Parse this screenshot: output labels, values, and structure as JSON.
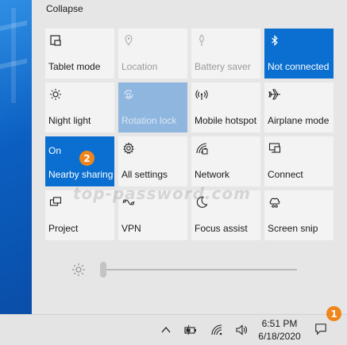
{
  "panel": {
    "collapse_label": "Collapse",
    "tiles": [
      {
        "label": "Tablet mode",
        "icon": "tablet-mode-icon",
        "state": ""
      },
      {
        "label": "Location",
        "icon": "location-icon",
        "state": ""
      },
      {
        "label": "Battery saver",
        "icon": "battery-saver-icon",
        "state": ""
      },
      {
        "label": "Not connected",
        "icon": "bluetooth-icon",
        "state": ""
      },
      {
        "label": "Night light",
        "icon": "night-light-icon",
        "state": ""
      },
      {
        "label": "Rotation lock",
        "icon": "rotation-lock-icon",
        "state": ""
      },
      {
        "label": "Mobile hotspot",
        "icon": "mobile-hotspot-icon",
        "state": ""
      },
      {
        "label": "Airplane mode",
        "icon": "airplane-icon",
        "state": ""
      },
      {
        "label": "Nearby sharing",
        "icon": "nearby-sharing-icon",
        "state": "On"
      },
      {
        "label": "All settings",
        "icon": "gear-icon",
        "state": ""
      },
      {
        "label": "Network",
        "icon": "network-icon",
        "state": ""
      },
      {
        "label": "Connect",
        "icon": "connect-icon",
        "state": ""
      },
      {
        "label": "Project",
        "icon": "project-icon",
        "state": ""
      },
      {
        "label": "VPN",
        "icon": "vpn-icon",
        "state": ""
      },
      {
        "label": "Focus assist",
        "icon": "moon-icon",
        "state": ""
      },
      {
        "label": "Screen snip",
        "icon": "screen-snip-icon",
        "state": ""
      }
    ],
    "watermark": "top-password.com",
    "brightness_level": 0.0
  },
  "badges": {
    "step_one": "1",
    "step_two": "2"
  },
  "colors": {
    "accent": "#0a6fd0",
    "tile": "#f3f3f3",
    "badge": "#f0861b"
  },
  "taskbar": {
    "time": "6:51 PM",
    "date": "6/18/2020"
  }
}
